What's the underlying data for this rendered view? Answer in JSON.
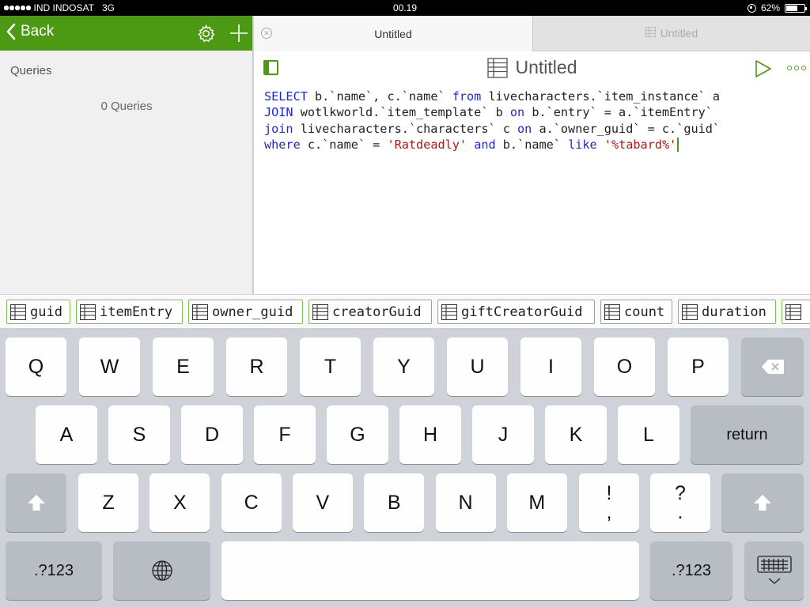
{
  "status_bar": {
    "carrier": "IND INDOSAT",
    "network": "3G",
    "time": "00.19",
    "battery": "62%",
    "battery_level": 0.62
  },
  "sidebar": {
    "back_label": "Back",
    "section_title": "Queries",
    "query_count": "0 Queries"
  },
  "tabs": [
    {
      "label": "Untitled",
      "active": true
    },
    {
      "label": "Untitled",
      "active": false
    }
  ],
  "document": {
    "title": "Untitled"
  },
  "editor": {
    "lines": [
      [
        {
          "t": "SELECT",
          "c": "kw"
        },
        {
          "t": " b.`name`, c.`name` "
        },
        {
          "t": "from",
          "c": "kw"
        },
        {
          "t": " livecharacters.`item_instance` a"
        }
      ],
      [
        {
          "t": "JOIN",
          "c": "kw"
        },
        {
          "t": " wotlkworld.`item_template` b "
        },
        {
          "t": "on",
          "c": "kw"
        },
        {
          "t": " b.`entry` = a.`itemEntry`"
        }
      ],
      [
        {
          "t": "join",
          "c": "kw"
        },
        {
          "t": " livecharacters.`characters` c "
        },
        {
          "t": "on",
          "c": "kw"
        },
        {
          "t": " a.`owner_guid` = c.`guid`"
        }
      ],
      [
        {
          "t": "where",
          "c": "kw"
        },
        {
          "t": " c.`name` = "
        },
        {
          "t": "'Ratdeadly'",
          "c": "str"
        },
        {
          "t": " "
        },
        {
          "t": "and",
          "c": "kw"
        },
        {
          "t": " b.`name` "
        },
        {
          "t": "like",
          "c": "kw"
        },
        {
          "t": " "
        },
        {
          "t": "'%tabard%'",
          "c": "str"
        }
      ]
    ],
    "keyword_color": "#2127d6",
    "string_color": "#b11818"
  },
  "column_chips": [
    "guid",
    "itemEntry",
    "owner_guid",
    "creatorGuid",
    "giftCreatorGuid",
    "count",
    "duration"
  ],
  "keyboard": {
    "row1": [
      "Q",
      "W",
      "E",
      "R",
      "T",
      "Y",
      "U",
      "I",
      "O",
      "P"
    ],
    "row2": [
      "A",
      "S",
      "D",
      "F",
      "G",
      "H",
      "J",
      "K",
      "L"
    ],
    "row3": [
      "Z",
      "X",
      "C",
      "V",
      "B",
      "N",
      "M"
    ],
    "return_label": "return",
    "numbers_label": ".?123",
    "punct1": [
      "!",
      ","
    ],
    "punct2": [
      "?",
      "."
    ]
  },
  "colors": {
    "accent": "#4c9a14",
    "chip_border": "#7cbf52"
  },
  "icons": {
    "back": "chevron-left-icon",
    "settings": "gear-icon",
    "add": "plus-icon",
    "table": "table-icon",
    "run": "play-icon",
    "more": "ellipsis-icon",
    "delete": "backspace-icon",
    "shift": "shift-arrow-icon",
    "globe": "globe-icon",
    "dismiss": "keyboard-dismiss-icon"
  }
}
